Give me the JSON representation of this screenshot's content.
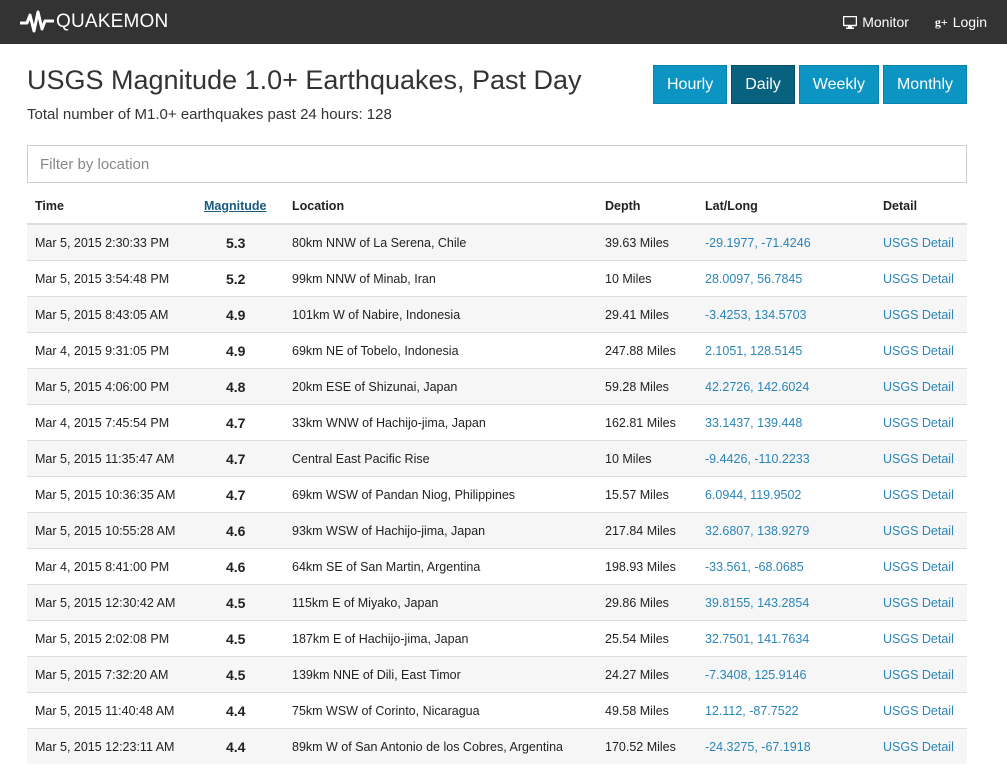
{
  "nav": {
    "brand": "QUAKEMON",
    "monitor": "Monitor",
    "login": "Login"
  },
  "header": {
    "title": "USGS Magnitude 1.0+ Earthquakes, Past Day",
    "subtitle": "Total number of M1.0+ earthquakes past 24 hours: 128"
  },
  "periods": [
    {
      "label": "Hourly",
      "active": false
    },
    {
      "label": "Daily",
      "active": true
    },
    {
      "label": "Weekly",
      "active": false
    },
    {
      "label": "Monthly",
      "active": false
    }
  ],
  "filter": {
    "placeholder": "Filter by location"
  },
  "table": {
    "columns": [
      "Time",
      "Magnitude",
      "Location",
      "Depth",
      "Lat/Long",
      "Detail"
    ],
    "rows": [
      {
        "time": "Mar 5, 2015 2:30:33 PM",
        "mag": "5.3",
        "location": "80km NNW of La Serena, Chile",
        "depth": "39.63 Miles",
        "latlong": "-29.1977, -71.4246",
        "detail": "USGS Detail"
      },
      {
        "time": "Mar 5, 2015 3:54:48 PM",
        "mag": "5.2",
        "location": "99km NNW of Minab, Iran",
        "depth": "10 Miles",
        "latlong": "28.0097, 56.7845",
        "detail": "USGS Detail"
      },
      {
        "time": "Mar 5, 2015 8:43:05 AM",
        "mag": "4.9",
        "location": "101km W of Nabire, Indonesia",
        "depth": "29.41 Miles",
        "latlong": "-3.4253, 134.5703",
        "detail": "USGS Detail"
      },
      {
        "time": "Mar 4, 2015 9:31:05 PM",
        "mag": "4.9",
        "location": "69km NE of Tobelo, Indonesia",
        "depth": "247.88 Miles",
        "latlong": "2.1051, 128.5145",
        "detail": "USGS Detail"
      },
      {
        "time": "Mar 5, 2015 4:06:00 PM",
        "mag": "4.8",
        "location": "20km ESE of Shizunai, Japan",
        "depth": "59.28 Miles",
        "latlong": "42.2726, 142.6024",
        "detail": "USGS Detail"
      },
      {
        "time": "Mar 4, 2015 7:45:54 PM",
        "mag": "4.7",
        "location": "33km WNW of Hachijo-jima, Japan",
        "depth": "162.81 Miles",
        "latlong": "33.1437, 139.448",
        "detail": "USGS Detail"
      },
      {
        "time": "Mar 5, 2015 11:35:47 AM",
        "mag": "4.7",
        "location": "Central East Pacific Rise",
        "depth": "10 Miles",
        "latlong": "-9.4426, -110.2233",
        "detail": "USGS Detail"
      },
      {
        "time": "Mar 5, 2015 10:36:35 AM",
        "mag": "4.7",
        "location": "69km WSW of Pandan Niog, Philippines",
        "depth": "15.57 Miles",
        "latlong": "6.0944, 119.9502",
        "detail": "USGS Detail"
      },
      {
        "time": "Mar 5, 2015 10:55:28 AM",
        "mag": "4.6",
        "location": "93km WSW of Hachijo-jima, Japan",
        "depth": "217.84 Miles",
        "latlong": "32.6807, 138.9279",
        "detail": "USGS Detail"
      },
      {
        "time": "Mar 4, 2015 8:41:00 PM",
        "mag": "4.6",
        "location": "64km SE of San Martin, Argentina",
        "depth": "198.93 Miles",
        "latlong": "-33.561, -68.0685",
        "detail": "USGS Detail"
      },
      {
        "time": "Mar 5, 2015 12:30:42 AM",
        "mag": "4.5",
        "location": "115km E of Miyako, Japan",
        "depth": "29.86 Miles",
        "latlong": "39.8155, 143.2854",
        "detail": "USGS Detail"
      },
      {
        "time": "Mar 5, 2015 2:02:08 PM",
        "mag": "4.5",
        "location": "187km E of Hachijo-jima, Japan",
        "depth": "25.54 Miles",
        "latlong": "32.7501, 141.7634",
        "detail": "USGS Detail"
      },
      {
        "time": "Mar 5, 2015 7:32:20 AM",
        "mag": "4.5",
        "location": "139km NNE of Dili, East Timor",
        "depth": "24.27 Miles",
        "latlong": "-7.3408, 125.9146",
        "detail": "USGS Detail"
      },
      {
        "time": "Mar 5, 2015 11:40:48 AM",
        "mag": "4.4",
        "location": "75km WSW of Corinto, Nicaragua",
        "depth": "49.58 Miles",
        "latlong": "12.112, -87.7522",
        "detail": "USGS Detail"
      },
      {
        "time": "Mar 5, 2015 12:23:11 AM",
        "mag": "4.4",
        "location": "89km W of San Antonio de los Cobres, Argentina",
        "depth": "170.52 Miles",
        "latlong": "-24.3275, -67.1918",
        "detail": "USGS Detail"
      }
    ]
  }
}
